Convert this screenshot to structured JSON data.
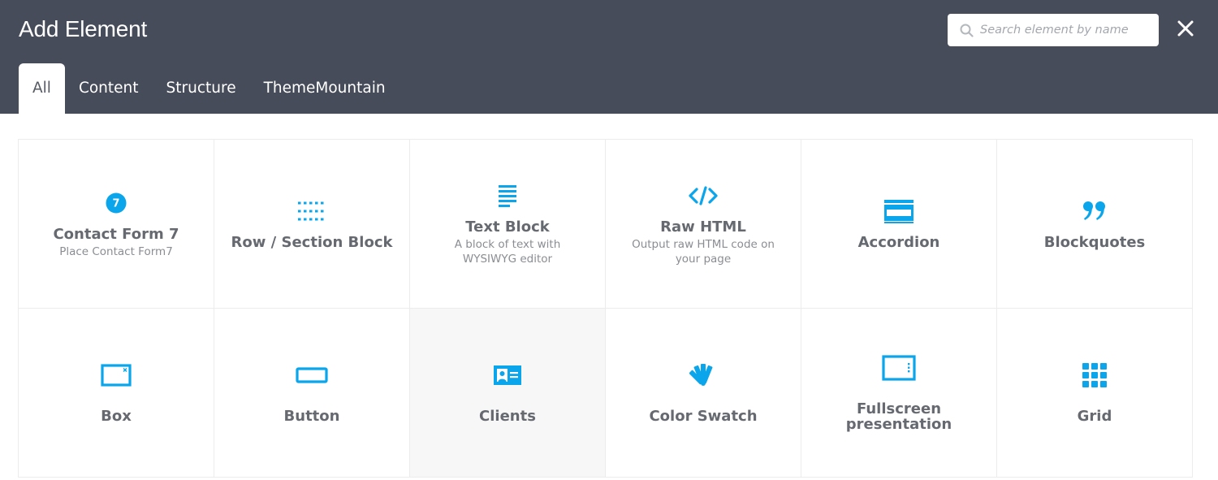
{
  "header": {
    "title": "Add Element",
    "search_placeholder": "Search element by name"
  },
  "tabs": [
    {
      "label": "All",
      "active": true
    },
    {
      "label": "Content",
      "active": false
    },
    {
      "label": "Structure",
      "active": false
    },
    {
      "label": "ThemeMountain",
      "active": false
    }
  ],
  "elements": [
    {
      "name": "Contact Form 7",
      "description": "Place Contact Form7",
      "icon": "contact-form-7-icon",
      "badge": "7"
    },
    {
      "name": "Row / Section Block",
      "description": "",
      "icon": "row-section-icon"
    },
    {
      "name": "Text Block",
      "description": "A block of text with WYSIWYG editor",
      "icon": "text-lines-icon"
    },
    {
      "name": "Raw HTML",
      "description": "Output raw HTML code on your page",
      "icon": "code-icon"
    },
    {
      "name": "Accordion",
      "description": "",
      "icon": "accordion-icon"
    },
    {
      "name": "Blockquotes",
      "description": "",
      "icon": "quote-icon"
    },
    {
      "name": "Box",
      "description": "",
      "icon": "box-icon"
    },
    {
      "name": "Button",
      "description": "",
      "icon": "button-icon"
    },
    {
      "name": "Clients",
      "description": "",
      "icon": "id-card-icon"
    },
    {
      "name": "Color Swatch",
      "description": "",
      "icon": "color-swatch-icon"
    },
    {
      "name": "Fullscreen presentation",
      "description": "",
      "icon": "fullscreen-icon"
    },
    {
      "name": "Grid",
      "description": "",
      "icon": "grid-icon"
    }
  ],
  "colors": {
    "header_bg": "#474c5a",
    "accent": "#0aa5ea",
    "text": "#666a70"
  }
}
